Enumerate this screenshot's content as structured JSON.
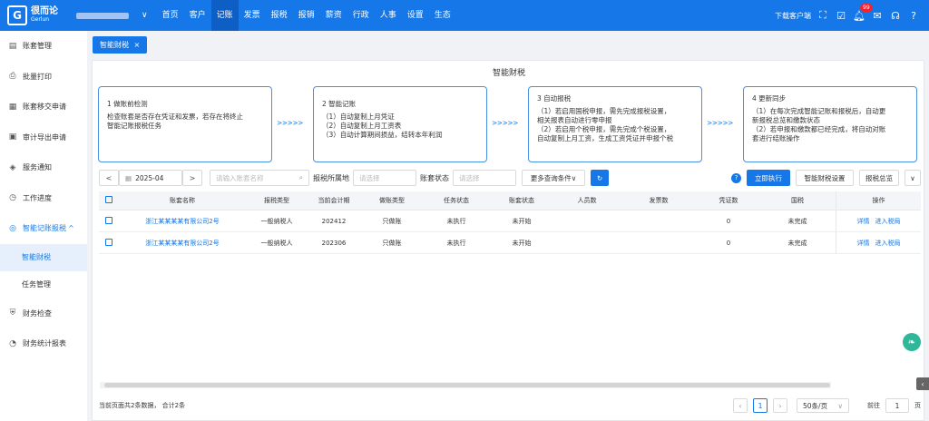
{
  "app": {
    "logo_mark": "G",
    "logo_name": "很而论",
    "logo_sub": "Gerlun"
  },
  "nav": [
    "首页",
    "客户",
    "记账",
    "发票",
    "报税",
    "报销",
    "薪资",
    "行政",
    "人事",
    "设置",
    "生态"
  ],
  "nav_active": 2,
  "topbar": {
    "download": "下载客户端",
    "notif_count": "99"
  },
  "sidebar": {
    "items": [
      {
        "label": "账套管理",
        "icon": "book-icon"
      },
      {
        "label": "批量打印",
        "icon": "printer-icon"
      },
      {
        "label": "账套移交申请",
        "icon": "document-icon"
      },
      {
        "label": "审计导出申请",
        "icon": "export-icon"
      },
      {
        "label": "服务通知",
        "icon": "bell-icon"
      },
      {
        "label": "工作进度",
        "icon": "clock-icon"
      },
      {
        "label": "智能记账报税",
        "icon": "smart-icon",
        "expanded": true
      },
      {
        "label": "财务检查",
        "icon": "shield-icon"
      },
      {
        "label": "财务统计报表",
        "icon": "chart-icon"
      }
    ],
    "sub": [
      {
        "label": "智能财税",
        "active": true
      },
      {
        "label": "任务管理",
        "active": false
      }
    ]
  },
  "tab": {
    "label": "智能财税",
    "close": "×"
  },
  "page": {
    "title": "智能财税"
  },
  "steps": [
    {
      "title": "1 做账前检测",
      "lines": [
        "检查账套是否存在凭证和发票，若存在将终止",
        "智能记账报税任务"
      ]
    },
    {
      "title": "2 智能记账",
      "lines": [
        "（1）自动复制上月凭证",
        "（2）自动复制上月工资表",
        "（3）自动计算期间损益，结转本年利润"
      ]
    },
    {
      "title": "3 自动报税",
      "lines": [
        "（1）若启用国税申报，需先完成报税设置，",
        "相关报表自动进行零申报",
        "（2）若启用个税申报，需先完成个税设置，",
        "自动复制上月工资，生成工资凭证并申报个税"
      ]
    },
    {
      "title": "4 更新同步",
      "lines": [
        "（1）在每次完成智能记账和报税后，自动更",
        "新报税总览和缴款状态",
        "（2）若申报和缴款都已经完成，将自动对账",
        "套进行结账操作"
      ]
    }
  ],
  "arrow": ">>>>>",
  "filter": {
    "prev": "<",
    "period": "2025-04",
    "next": ">",
    "name_placeholder": "请输入账套名称",
    "region_label": "报税所属地",
    "region_placeholder": "请选择",
    "status_label": "账套状态",
    "status_placeholder": "请选择",
    "more": "更多查询条件∨",
    "run": "立即执行",
    "settings": "智能财税设置",
    "overview": "报税总览"
  },
  "table": {
    "headers": [
      "账套名称",
      "报税类型",
      "当前会计期",
      "做账类型",
      "任务状态",
      "账套状态",
      "人员数",
      "发票数",
      "凭证数",
      "国税",
      "操作"
    ],
    "rows": [
      {
        "name": "浙江某某某某有限公司2号",
        "tax_type": "一般纳税人",
        "period": "202412",
        "book_type": "只做账",
        "task_status": "未执行",
        "book_status": "未开始",
        "staff": "",
        "invoices": "",
        "vouchers": "0",
        "national_tax": "未完成",
        "op1": "详情",
        "op2": "进入税局"
      },
      {
        "name": "浙江某某某某有限公司2号",
        "tax_type": "一般纳税人",
        "period": "202306",
        "book_type": "只做账",
        "task_status": "未执行",
        "book_status": "未开始",
        "staff": "",
        "invoices": "",
        "vouchers": "0",
        "national_tax": "未完成",
        "op1": "详情",
        "op2": "进入税局"
      }
    ]
  },
  "footer": {
    "summary": "当前页面共2条数据， 合计2条",
    "page": "1",
    "page_size": "50条/页",
    "goto_label": "前往",
    "goto_value": "1",
    "page_unit": "页"
  },
  "colors": {
    "primary": "#1677e8",
    "active_nav": "#0d5fc6",
    "sidebar_active_bg": "#e6f0fd"
  }
}
